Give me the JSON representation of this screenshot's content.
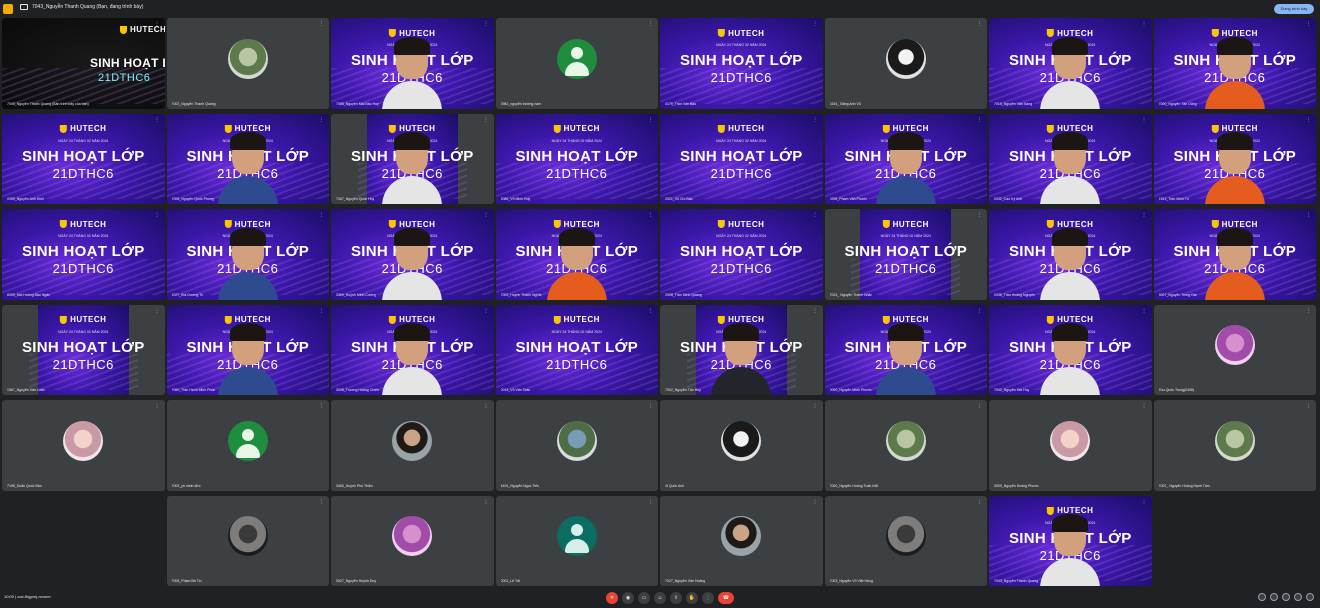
{
  "topbar": {
    "presenting_label": "7043_Nguyễn Thanh Quang (Bạn, đang trình bày)",
    "stop_label": "Dừng trình bày"
  },
  "slide": {
    "logo": "HUTECH",
    "date": "NGÀY 24 THÁNG 02 NĂM 2024",
    "title": "SINH HOẠT LỚP",
    "code": "21DTHC6"
  },
  "tiles": [
    {
      "name": "7043_Nguyễn Thanh Quang (Bản trình bày của bạn)",
      "kind": "present"
    },
    {
      "name": "7002_Nguyễn Thanh Quang",
      "kind": "avatar",
      "avatar": "photo7"
    },
    {
      "name": "7088_Nguyễn Mai Bảo Huy",
      "kind": "slide-person"
    },
    {
      "name": "2982_nguyễn trường nam",
      "kind": "avatar",
      "avatar": "green"
    },
    {
      "name": "0176_Trần Văn Bảo",
      "kind": "slide"
    },
    {
      "name": "0244_ Đặng Anh Vũ",
      "kind": "avatar",
      "avatar": "photo6"
    },
    {
      "name": "7015_Nguyễn Văn Sang",
      "kind": "slide-person"
    },
    {
      "name": "7000_Nguyễn Tấn Dũng",
      "kind": "slide-person"
    },
    {
      "name": "0390_Nguyễn Anh Khôi",
      "kind": "slide"
    },
    {
      "name": "7006_Nguyễn Quốc Phong",
      "kind": "slide-person"
    },
    {
      "name": "7067_Nguyễn Quốc Huy",
      "kind": "slide-narrow-person"
    },
    {
      "name": "2086_Võ Minh Huy",
      "kind": "slide"
    },
    {
      "name": "2021_Võ Chí Bảo",
      "kind": "slide"
    },
    {
      "name": "0296_Phạm Văn Phước",
      "kind": "slide-person"
    },
    {
      "name": "2032_Cao Kỳ Anh",
      "kind": "slide-person"
    },
    {
      "name": "2161_Trần Minh Trí",
      "kind": "slide-person"
    },
    {
      "name": "6009_Mai Hoàng Bảo Ngân",
      "kind": "slide"
    },
    {
      "name": "1027_Bùi Dương Trí",
      "kind": "slide-person"
    },
    {
      "name": "3369_Huỳnh Minh Cường",
      "kind": "slide-person"
    },
    {
      "name": "7003_Huỳnh Thành Nghĩa",
      "kind": "slide-person"
    },
    {
      "name": "2908_Trần Minh Quang",
      "kind": "slide"
    },
    {
      "name": "7024_ Nguyễn Thành Nhân",
      "kind": "slide-narrow"
    },
    {
      "name": "0036_Trần Hoàng Nguyên",
      "kind": "slide-person"
    },
    {
      "name": "3007_Nguyễn Trung Đạt",
      "kind": "slide-person"
    },
    {
      "name": "1567_Nguyễn Văn Luân",
      "kind": "slide-narrow"
    },
    {
      "name": "7060_Trần Hạnh Minh Phúc",
      "kind": "slide-person"
    },
    {
      "name": "3008_Trương Hoàng Chiến",
      "kind": "slide-person"
    },
    {
      "name": "0014_Võ Văn Toàn",
      "kind": "slide"
    },
    {
      "name": "7002_Nguyễn Tấn Huy",
      "kind": "slide-narrow-person"
    },
    {
      "name": "0000_Nguyễn Minh Phước",
      "kind": "slide-person"
    },
    {
      "name": "7042_Nguyễn Gia Huy",
      "kind": "slide-person"
    },
    {
      "name": "Zhu-Quốc Trung(0408)",
      "kind": "avatar",
      "avatar": "photo8"
    },
    {
      "name": "7198_Doãn Quốc Bảo",
      "kind": "avatar",
      "avatar": "photo4"
    },
    {
      "name": "7003_yh minh đức",
      "kind": "avatar",
      "avatar": "green"
    },
    {
      "name": "3450_Huỳnh Phú Thiện",
      "kind": "avatar",
      "avatar": "photo2"
    },
    {
      "name": "4404_Nguyễn Ngọc Tiến",
      "kind": "avatar",
      "avatar": "photo3"
    },
    {
      "name": "4I Quốc Anh",
      "kind": "avatar",
      "avatar": "photo6"
    },
    {
      "name": "7000_Nguyễn Hoàng Tuấn Kiệt",
      "kind": "avatar",
      "avatar": "photo7"
    },
    {
      "name": "3009_Nguyễn Hoàng Phước",
      "kind": "avatar",
      "avatar": "photo4"
    },
    {
      "name": "7002_ Nguyễn Hoàng Hạnh Tâm",
      "kind": "avatar",
      "avatar": "photo7"
    },
    {
      "name": "",
      "kind": "empty"
    },
    {
      "name": "7008_Phạm Bá Tín",
      "kind": "avatar",
      "avatar": "photo5"
    },
    {
      "name": "3027_Nguyễn Huỳnh Duy",
      "kind": "avatar",
      "avatar": "photo8"
    },
    {
      "name": "0001_Lê Tài",
      "kind": "avatar",
      "avatar": "teal"
    },
    {
      "name": "7027_Nguyễn Văn Hoàng",
      "kind": "avatar",
      "avatar": "photo2"
    },
    {
      "name": "7003_Nguyễn Võ Việt Hùng",
      "kind": "avatar",
      "avatar": "photo5"
    },
    {
      "name": "7043_Nguyễn Thanh Quang",
      "kind": "slide-person"
    },
    {
      "name": "",
      "kind": "empty"
    }
  ],
  "bottombar": {
    "clock": "10:00  |  coe-ffqgrmj-nxnnm"
  }
}
